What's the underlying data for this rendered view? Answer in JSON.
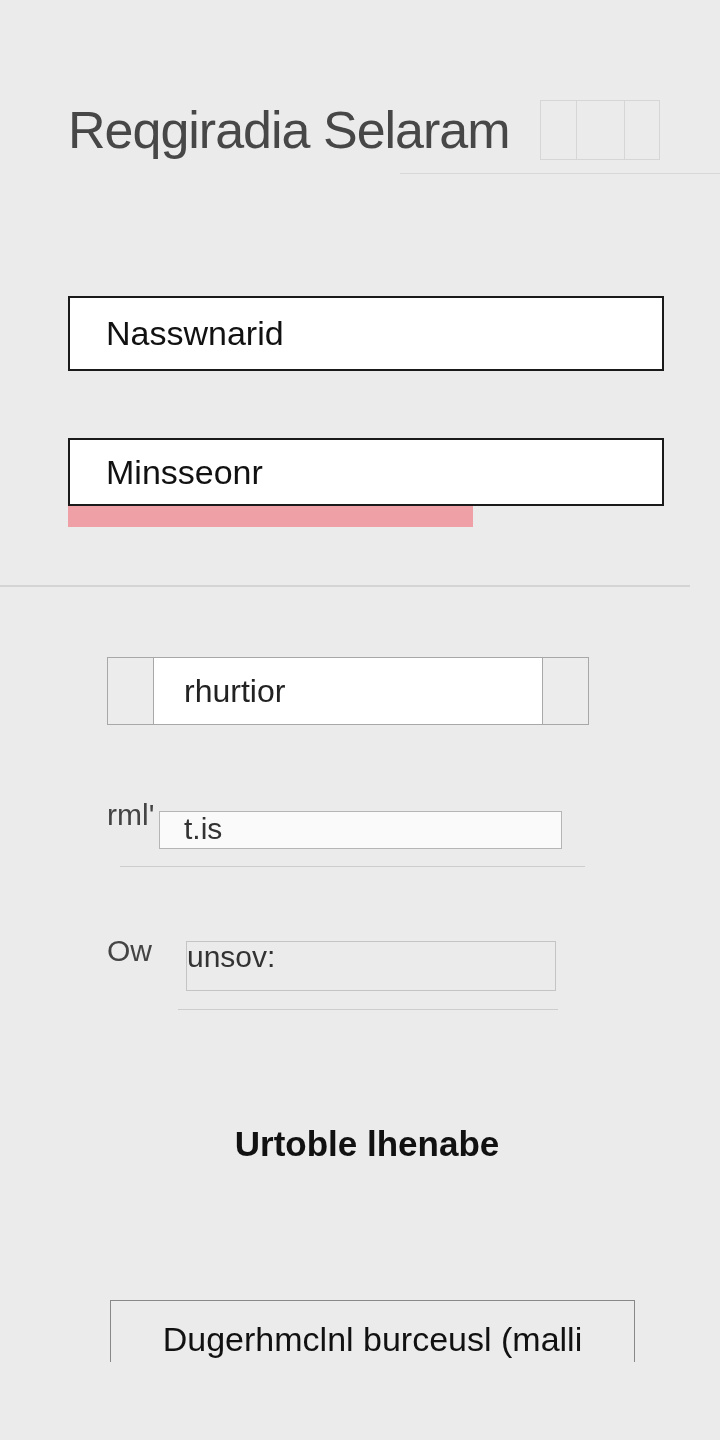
{
  "header": {
    "title": "Reqgiradia Selaram"
  },
  "fields": [
    {
      "value": "Nasswnarid"
    },
    {
      "value": "Minsseonr",
      "level": 0.68
    }
  ],
  "stepper": {
    "value": "rhurtior"
  },
  "rows": [
    {
      "kind": "filled",
      "label": "rml'",
      "value": "t.is"
    },
    {
      "kind": "outlined",
      "label": "Ow",
      "value": "unsov:"
    }
  ],
  "heading": "Urtoble lhenabe",
  "button": {
    "label": "Dugerhmclnl burceusl (malli"
  }
}
